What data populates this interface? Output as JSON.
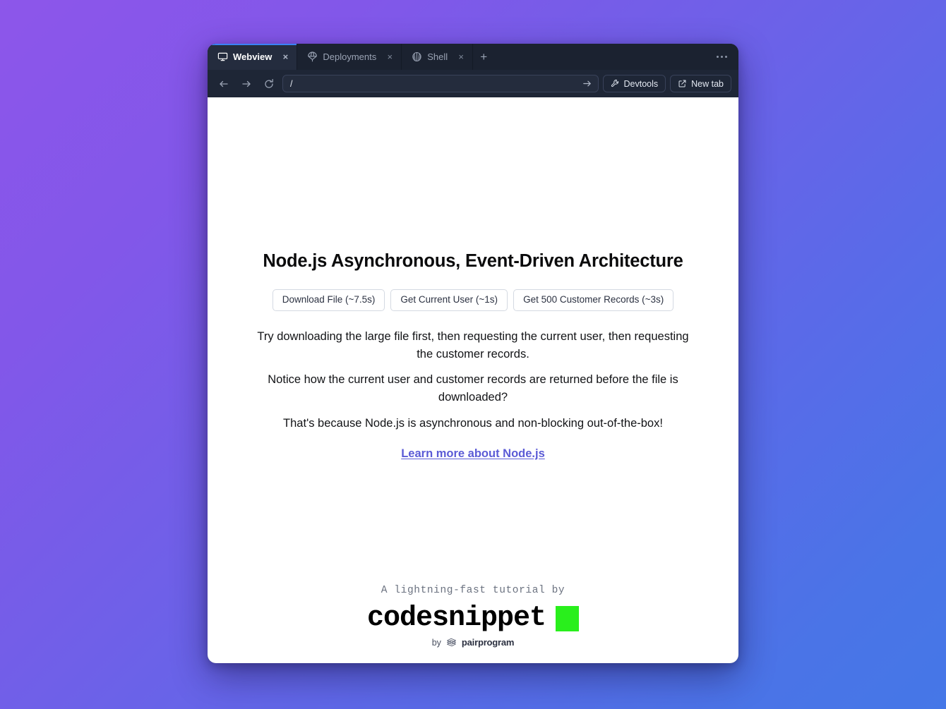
{
  "window": {
    "menu_button_label": "window-menu"
  },
  "tabs": [
    {
      "label": "Webview",
      "icon": "monitor-icon",
      "active": true,
      "close_label": "×"
    },
    {
      "label": "Deployments",
      "icon": "parachute-icon",
      "active": false,
      "close_label": "×"
    },
    {
      "label": "Shell",
      "icon": "shell-icon",
      "active": false,
      "close_label": "×"
    }
  ],
  "new_tab_button_label": "+",
  "toolbar": {
    "back_icon": "arrow-left-icon",
    "forward_icon": "arrow-right-icon",
    "reload_icon": "reload-icon",
    "url_value": "/",
    "url_placeholder": "/",
    "go_icon": "arrow-right-icon",
    "devtools_label": "Devtools",
    "new_tab_label": "New tab"
  },
  "page": {
    "title": "Node.js Asynchronous, Event-Driven Architecture",
    "buttons": [
      "Download File (~7.5s)",
      "Get Current User (~1s)",
      "Get 500 Customer Records (~3s)"
    ],
    "paragraphs": [
      "Try downloading the large file first, then requesting the current user, then requesting the customer records.",
      "Notice how the current user and customer records are returned before the file is downloaded?",
      "That's because Node.js is asynchronous and non-blocking out-of-the-box!"
    ],
    "link_text": "Learn more about Node.js"
  },
  "footer": {
    "tagline": "A lightning-fast tutorial by",
    "brand": "codesnippet",
    "byline_prefix": "by",
    "byline_brand": "pairprogram"
  },
  "colors": {
    "desktop_gradient_start": "#8d56ea",
    "desktop_gradient_end": "#4577e7",
    "chrome_background": "#1e2636",
    "active_tab_background": "#242c3e",
    "active_tab_accent": "#3b82f6",
    "link": "#5b5bd6",
    "brand_square": "#29ef1c"
  }
}
